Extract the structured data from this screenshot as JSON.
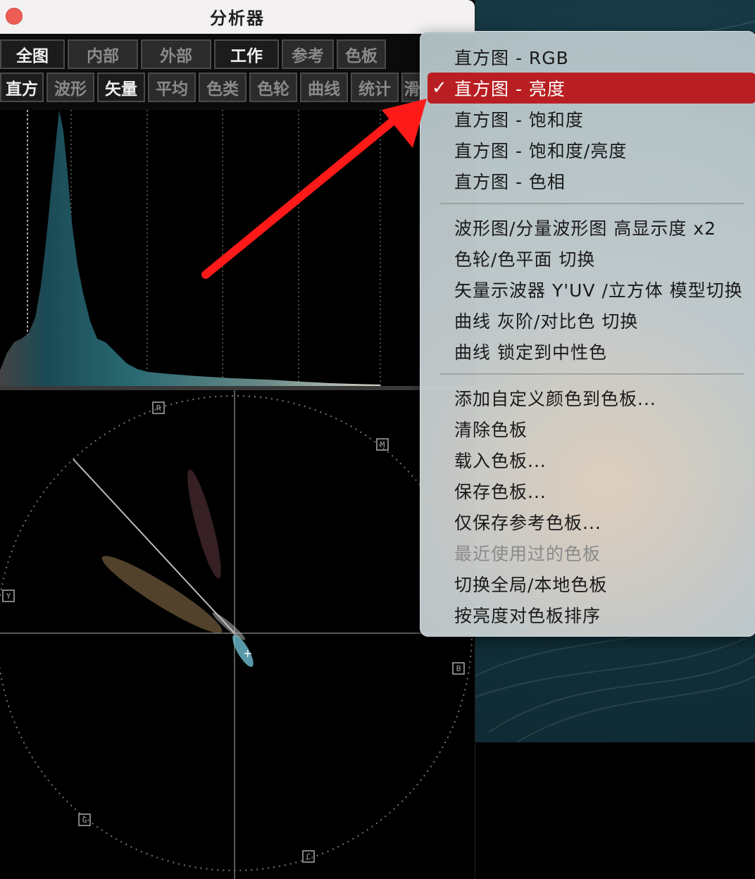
{
  "window": {
    "title": "分析器"
  },
  "toolbar": {
    "row1": [
      {
        "label": "全图",
        "active": true
      },
      {
        "label": "内部",
        "active": false
      },
      {
        "label": "外部",
        "active": false
      },
      {
        "label": "工作",
        "active": true
      },
      {
        "label": "参考",
        "active": false
      },
      {
        "label": "色板",
        "active": false
      }
    ],
    "row2": [
      {
        "label": "直方",
        "active": true
      },
      {
        "label": "波形",
        "active": false
      },
      {
        "label": "矢量",
        "active": true
      },
      {
        "label": "平均",
        "active": false
      },
      {
        "label": "色类",
        "active": false
      },
      {
        "label": "色轮",
        "active": false
      },
      {
        "label": "曲线",
        "active": false
      },
      {
        "label": "统计",
        "active": false
      },
      {
        "label": "滑",
        "active": false
      }
    ]
  },
  "vectorscope": {
    "targets": [
      "R",
      "M",
      "B",
      "C",
      "G",
      "Y"
    ]
  },
  "menu": {
    "items_group1": [
      {
        "label": "直方图 - RGB",
        "selected": false
      },
      {
        "label": "直方图 - 亮度",
        "selected": true
      },
      {
        "label": "直方图 - 饱和度",
        "selected": false
      },
      {
        "label": "直方图 - 饱和度/亮度",
        "selected": false
      },
      {
        "label": "直方图 - 色相",
        "selected": false
      }
    ],
    "items_group2": [
      {
        "label": "波形图/分量波形图 高显示度 x2"
      },
      {
        "label": "色轮/色平面 切换"
      },
      {
        "label": "矢量示波器 Y'UV /立方体 模型切换"
      },
      {
        "label": "曲线 灰阶/对比色 切换"
      },
      {
        "label": "曲线 锁定到中性色"
      }
    ],
    "items_group3": [
      {
        "label": "添加自定义颜色到色板...",
        "disabled": false
      },
      {
        "label": "清除色板",
        "disabled": false
      },
      {
        "label": "载入色板...",
        "disabled": false
      },
      {
        "label": "保存色板...",
        "disabled": false
      },
      {
        "label": "仅保存参考色板...",
        "disabled": false
      },
      {
        "label": "最近使用过的色板",
        "disabled": true
      },
      {
        "label": "切换全局/本地色板",
        "disabled": false
      },
      {
        "label": "按亮度对色板排序",
        "disabled": false
      }
    ],
    "checkmark": "✓"
  },
  "colors": {
    "selection": "#b91f22",
    "histogram_fill": "#2d6b73",
    "annotation_arrow": "#ff1a1a"
  }
}
